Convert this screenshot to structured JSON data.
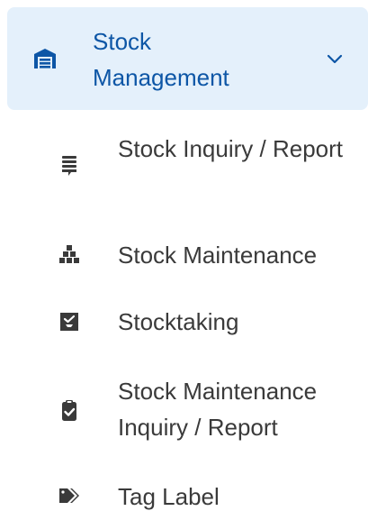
{
  "sidebar": {
    "group": {
      "label": "Stock Management",
      "icon": "warehouse-icon",
      "expanded": true,
      "chevron_icon": "chevron-down-icon"
    },
    "items": [
      {
        "label": "Stock Inquiry / Report",
        "icon": "report-list-icon"
      },
      {
        "label": "Stock Maintenance",
        "icon": "boxes-icon"
      },
      {
        "label": "Stocktaking",
        "icon": "inbox-check-icon"
      },
      {
        "label": "Stock Maintenance Inquiry / Report",
        "icon": "clipboard-check-icon"
      },
      {
        "label": "Tag Label",
        "icon": "tags-icon"
      }
    ]
  },
  "colors": {
    "active_bg": "#e4f0fb",
    "active_text": "#0d56a6",
    "text": "#3a3a3a"
  }
}
